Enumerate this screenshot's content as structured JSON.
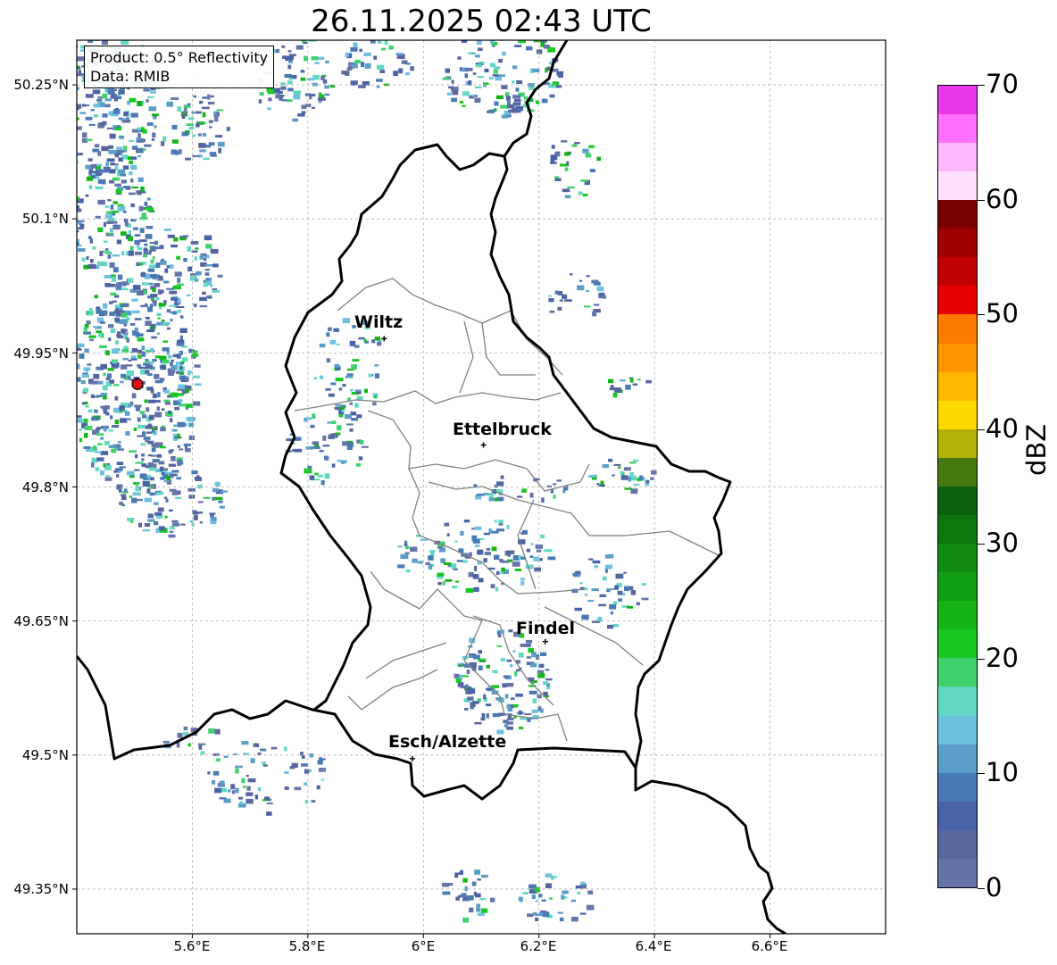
{
  "title": "26.11.2025 02:43 UTC",
  "info": {
    "product": "Product: 0.5° Reflectivity",
    "data": "Data: RMIB"
  },
  "axes": {
    "lat_labels": [
      "50.25°N",
      "50.1°N",
      "49.95°N",
      "49.8°N",
      "49.65°N",
      "49.5°N",
      "49.35°N"
    ],
    "lon_labels": [
      "5.6°E",
      "5.8°E",
      "6°E",
      "6.2°E",
      "6.4°E",
      "6.6°E"
    ],
    "lat_range": [
      49.3,
      50.3
    ],
    "lon_range": [
      5.4,
      6.8
    ],
    "grid": true
  },
  "cities": [
    {
      "name": "Wiltz",
      "lat": 49.966,
      "lon": 5.932
    },
    {
      "name": "Ettelbruck",
      "lat": 49.847,
      "lon": 6.104
    },
    {
      "name": "Findel",
      "lat": 49.627,
      "lon": 6.211
    },
    {
      "name": "Esch/Alzette",
      "lat": 49.496,
      "lon": 5.981
    }
  ],
  "radar_site": {
    "lat": 49.915,
    "lon": 5.505,
    "color": "#e01010"
  },
  "colorbar": {
    "label": "dBZ",
    "min": 0,
    "max": 70,
    "ticks": [
      "0",
      "10",
      "20",
      "30",
      "40",
      "50",
      "60",
      "70"
    ],
    "colors": [
      "#6474a8",
      "#5866a0",
      "#4a62a6",
      "#4a7ab4",
      "#5a9ec8",
      "#6cc0e0",
      "#62d8c4",
      "#40d06c",
      "#16c820",
      "#14b416",
      "#129e12",
      "#108a10",
      "#0e760e",
      "#0c600c",
      "#457a10",
      "#b0b20a",
      "#ffd800",
      "#ffb800",
      "#ff9800",
      "#ff7a00",
      "#e60000",
      "#c00000",
      "#a00000",
      "#7a0000",
      "#ffe0ff",
      "#ffb8ff",
      "#ff70ff",
      "#e838e8"
    ]
  },
  "colors": {
    "border": "#000000",
    "cantons": "#808080",
    "grid": "#b0b0b0"
  }
}
